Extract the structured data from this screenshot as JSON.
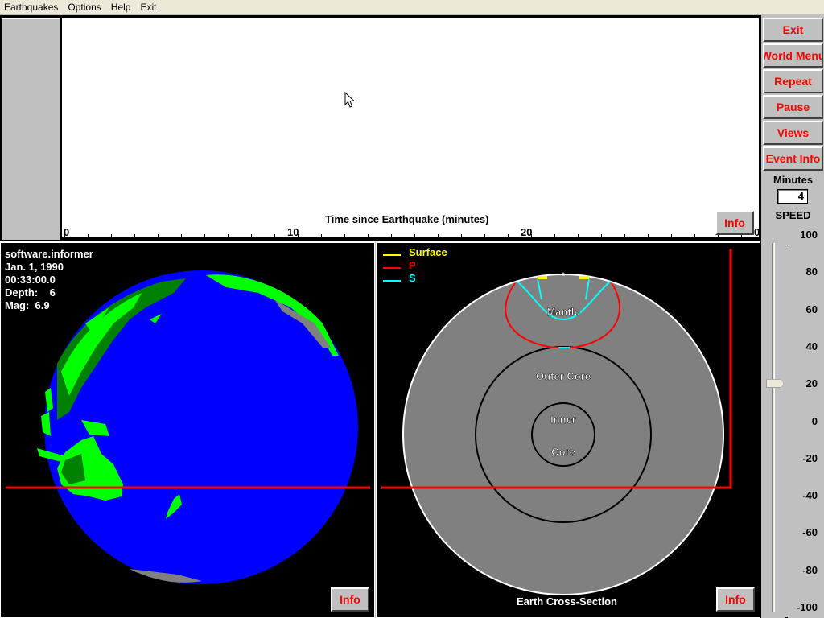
{
  "menubar": {
    "items": [
      "Earthquakes",
      "Options",
      "Help",
      "Exit"
    ]
  },
  "seismograph": {
    "axis_title": "Time since Earthquake (minutes)",
    "tick_labels": [
      "0",
      "10",
      "20",
      "0"
    ],
    "axis_range_minutes": [
      0,
      30
    ],
    "info_label": "Info"
  },
  "sidebar": {
    "buttons": [
      "Exit",
      "World Menu",
      "Repeat",
      "Pause",
      "Views",
      "Event Info"
    ],
    "minutes_label": "Minutes",
    "minutes_value": "4",
    "speed_label": "SPEED",
    "speed_ticks": [
      "100",
      "80",
      "60",
      "40",
      "20",
      "0",
      "-20",
      "-40",
      "-60",
      "-80",
      "-100"
    ],
    "speed_value": 20,
    "speed_range": [
      -100,
      100
    ]
  },
  "globe": {
    "source": "software.informer",
    "date": "Jan. 1, 1990",
    "time": "00:33:00.0",
    "depth": "Depth:    6",
    "mag": "Mag:  6.9",
    "info_label": "Info",
    "colors": {
      "ocean": "#0000ff",
      "land": "#00ff00",
      "land_dark": "#008000",
      "ice": "#808080",
      "marker": "#ff0000"
    }
  },
  "cross_section": {
    "title": "Earth Cross-Section",
    "legend": [
      {
        "label": "Surface",
        "color": "#ffff00"
      },
      {
        "label": "P",
        "color": "#ff0000"
      },
      {
        "label": "S",
        "color": "#00ffff"
      }
    ],
    "layers": [
      "Mantle",
      "Outer Core",
      "Inner",
      "Core"
    ],
    "epicenter_marker": "*",
    "info_label": "Info"
  }
}
